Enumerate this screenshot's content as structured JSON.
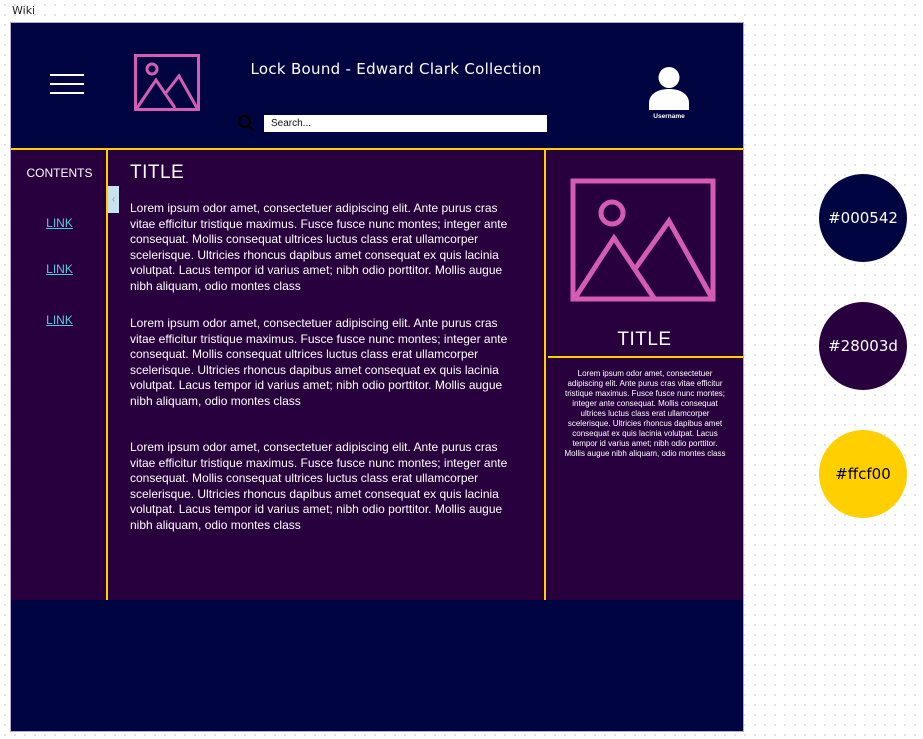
{
  "frame_label": "Wiki",
  "header": {
    "title": "Lock Bound - Edward Clark Collection",
    "search_placeholder": "Search...",
    "username": "Username"
  },
  "sidebar": {
    "title": "CONTENTS",
    "links": [
      "LINK",
      "LINK",
      "LINK"
    ]
  },
  "collapse_glyph": "‹",
  "main": {
    "title": "TITLE",
    "paragraphs": [
      "Lorem ipsum odor amet, consectetuer adipiscing elit. Ante purus cras vitae efficitur tristique maximus. Fusce fusce nunc montes; integer ante consequat. Mollis consequat ultrices luctus class erat ullamcorper scelerisque. Ultricies rhoncus dapibus amet consequat ex quis lacinia volutpat. Lacus tempor id varius amet; nibh odio porttitor. Mollis augue nibh aliquam, odio montes class",
      "Lorem ipsum odor amet, consectetuer adipiscing elit. Ante purus cras vitae efficitur tristique maximus. Fusce fusce nunc montes; integer ante consequat. Mollis consequat ultrices luctus class erat ullamcorper scelerisque. Ultricies rhoncus dapibus amet consequat ex quis lacinia volutpat. Lacus tempor id varius amet; nibh odio porttitor. Mollis augue nibh aliquam, odio montes class",
      "Lorem ipsum odor amet, consectetuer adipiscing elit. Ante purus cras vitae efficitur tristique maximus. Fusce fusce nunc montes; integer ante consequat. Mollis consequat ultrices luctus class erat ullamcorper scelerisque. Ultricies rhoncus dapibus amet consequat ex quis lacinia volutpat. Lacus tempor id varius amet; nibh odio porttitor. Mollis augue nibh aliquam, odio montes class"
    ]
  },
  "panel": {
    "title": "TITLE",
    "text": "Lorem ipsum odor amet, consectetuer adipiscing elit. Ante purus cras vitae efficitur tristique maximus. Fusce fusce nunc montes; integer ante consequat. Mollis consequat ultrices luctus class erat ullamcorper scelerisque. Ultricies rhoncus dapibus amet consequat ex quis lacinia volutpat. Lacus tempor id varius amet; nibh odio porttitor. Mollis augue nibh aliquam, odio montes class"
  },
  "palette": [
    {
      "label": "#000542",
      "color": "#000542",
      "text_color": "#ffffff"
    },
    {
      "label": "#28003d",
      "color": "#28003d",
      "text_color": "#ffffff"
    },
    {
      "label": "#ffcf00",
      "color": "#ffcf00",
      "text_color": "#000000"
    }
  ],
  "icons": {
    "menu": "hamburger-menu-icon",
    "logo": "image-placeholder-icon",
    "search": "magnifier-icon",
    "user": "user-avatar-icon"
  },
  "colors": {
    "navy": "#000542",
    "purple": "#28003d",
    "gold": "#ffcf00",
    "accent_pink": "#d45db3",
    "link": "#5cc8e0"
  }
}
